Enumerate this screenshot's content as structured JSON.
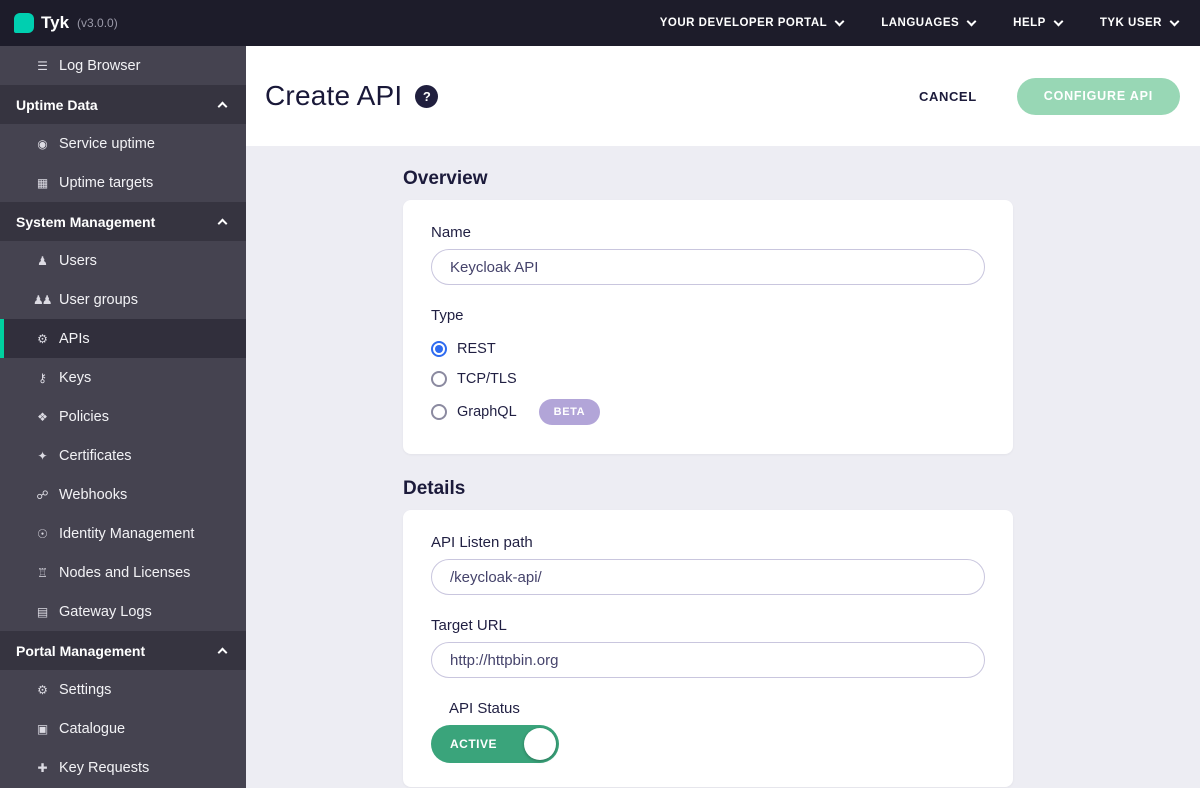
{
  "topnav": {
    "brand": "Tyk",
    "version": "(v3.0.0)",
    "menus": [
      {
        "label": "YOUR DEVELOPER PORTAL"
      },
      {
        "label": "LANGUAGES"
      },
      {
        "label": "HELP"
      },
      {
        "label": "TYK USER"
      }
    ]
  },
  "sidebar": {
    "items": [
      {
        "kind": "item",
        "label": "Log Browser",
        "icon": "☰"
      },
      {
        "kind": "section",
        "label": "Uptime Data"
      },
      {
        "kind": "item",
        "label": "Service uptime",
        "icon": "◉"
      },
      {
        "kind": "item",
        "label": "Uptime targets",
        "icon": "▦"
      },
      {
        "kind": "section",
        "label": "System Management"
      },
      {
        "kind": "item",
        "label": "Users",
        "icon": "♟"
      },
      {
        "kind": "item",
        "label": "User groups",
        "icon": "♟♟"
      },
      {
        "kind": "item",
        "label": "APIs",
        "icon": "⚙",
        "active": true
      },
      {
        "kind": "item",
        "label": "Keys",
        "icon": "⚷"
      },
      {
        "kind": "item",
        "label": "Policies",
        "icon": "❖"
      },
      {
        "kind": "item",
        "label": "Certificates",
        "icon": "✦"
      },
      {
        "kind": "item",
        "label": "Webhooks",
        "icon": "☍"
      },
      {
        "kind": "item",
        "label": "Identity Management",
        "icon": "☉"
      },
      {
        "kind": "item",
        "label": "Nodes and Licenses",
        "icon": "♖"
      },
      {
        "kind": "item",
        "label": "Gateway Logs",
        "icon": "▤"
      },
      {
        "kind": "section",
        "label": "Portal Management"
      },
      {
        "kind": "item",
        "label": "Settings",
        "icon": "⚙"
      },
      {
        "kind": "item",
        "label": "Catalogue",
        "icon": "▣"
      },
      {
        "kind": "item",
        "label": "Key Requests",
        "icon": "✚"
      }
    ]
  },
  "header": {
    "title": "Create API",
    "help_icon": "?",
    "cancel_label": "CANCEL",
    "configure_label": "CONFIGURE API"
  },
  "overview": {
    "heading": "Overview",
    "name_label": "Name",
    "name_value": "Keycloak API",
    "type_label": "Type",
    "options": [
      {
        "label": "REST",
        "selected": true
      },
      {
        "label": "TCP/TLS",
        "selected": false
      },
      {
        "label": "GraphQL",
        "selected": false,
        "badge": "BETA"
      }
    ]
  },
  "details": {
    "heading": "Details",
    "listen_path_label": "API Listen path",
    "listen_path_value": "/keycloak-api/",
    "target_url_label": "Target URL",
    "target_url_value": "http://httpbin.org",
    "api_status_label": "API Status",
    "api_status_value": "ACTIVE"
  },
  "colors": {
    "accent_teal": "#00d1a0",
    "configure_button_green": "#98d7b5",
    "toggle_active_green": "#3aa47b",
    "beta_badge_purple": "#b2a5d8",
    "radio_selected_blue": "#2e6bf0",
    "topnav_navy": "#1d1c2a",
    "sidebar_gray": "#454350",
    "content_background": "#ededf3"
  }
}
